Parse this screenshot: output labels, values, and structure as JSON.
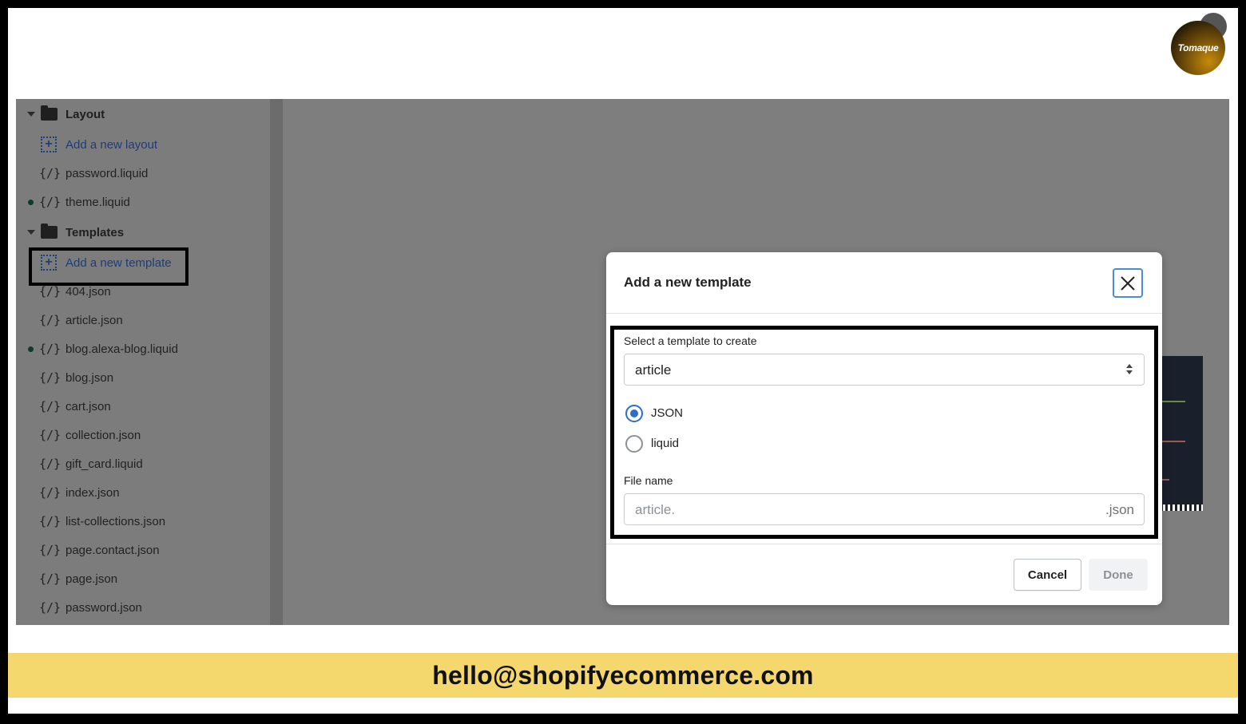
{
  "brand": {
    "logo_text": "Tomaque"
  },
  "sidebar": {
    "layout_folder": "Layout",
    "add_layout": "Add a new layout",
    "layout_files": [
      "password.liquid",
      "theme.liquid"
    ],
    "templates_folder": "Templates",
    "add_template": "Add a new template",
    "template_files": [
      "404.json",
      "article.json",
      "blog.alexa-blog.liquid",
      "blog.json",
      "cart.json",
      "collection.json",
      "gift_card.liquid",
      "index.json",
      "list-collections.json",
      "page.contact.json",
      "page.json",
      "password.json"
    ],
    "file_icon_glyph": "{/}"
  },
  "modal": {
    "title": "Add a new template",
    "select_label": "Select a template to create",
    "select_value": "article",
    "radio_options": [
      "JSON",
      "liquid"
    ],
    "radio_selected": "JSON",
    "file_name_label": "File name",
    "file_name_placeholder": "article.",
    "file_name_suffix": ".json",
    "cancel_label": "Cancel",
    "done_label": "Done"
  },
  "colors": {
    "accent": "#2c6ecb",
    "overlay": "#7e7e7e",
    "banner": "#f4d86e",
    "link": "#1e3d78"
  },
  "footer": {
    "contact_email": "hello@shopifyecommerce.com"
  }
}
